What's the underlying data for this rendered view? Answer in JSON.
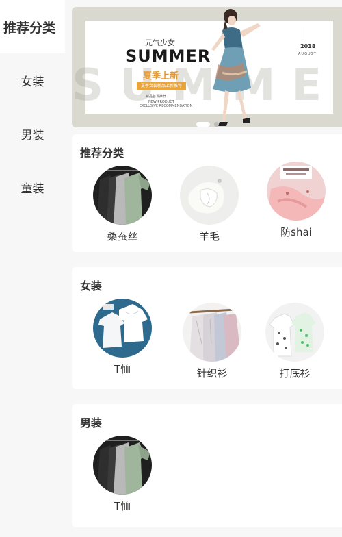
{
  "sidebar": {
    "items": [
      {
        "label": "推荐分类",
        "active": true
      },
      {
        "label": "女装",
        "active": false
      },
      {
        "label": "男装",
        "active": false
      },
      {
        "label": "童装",
        "active": false
      }
    ]
  },
  "banner": {
    "kicker": "元气少女",
    "title": "SUMMER",
    "subtitle": "夏季上新",
    "tag": "夏季女装新品上新推荐",
    "line1": "新品首发推荐",
    "line2": "NEW PRODUCT",
    "line3": "EXCLUSIVE RECOMMENDATION",
    "year": "2018",
    "month": "AUGUST",
    "background_word": "SUMMER",
    "slide_count": 2,
    "active_slide": 1,
    "colors": {
      "frame": "#d9d9cf",
      "accent": "#eaa43c"
    }
  },
  "sections": [
    {
      "title": "推荐分类",
      "items": [
        {
          "label": "桑蚕丝",
          "image": "dark-shirts-on-hangers"
        },
        {
          "label": "羊毛",
          "image": "white-wool-sweater"
        },
        {
          "label": "防shai",
          "image": "pink-sun-protection-clothing"
        }
      ]
    },
    {
      "title": "女装",
      "items": [
        {
          "label": "T恤",
          "image": "white-tshirts-on-blue"
        },
        {
          "label": "针织衫",
          "image": "cardigans-on-hangers"
        },
        {
          "label": "打底衫",
          "image": "printed-tops-on-hangers"
        }
      ]
    },
    {
      "title": "男装",
      "items": [
        {
          "label": "T恤",
          "image": "dark-shirts-on-hangers"
        }
      ]
    }
  ]
}
